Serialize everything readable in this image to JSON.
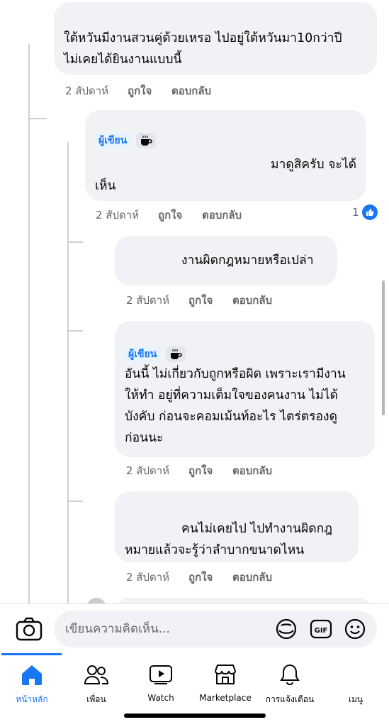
{
  "comments": [
    {
      "text_lines": [
        "ใต้หวันมีงานสวนคู่ด้วยเหรอ ไปอยู่ใต้หวันมา10กว่าปี",
        "ไม่เคยได้ยินงานแบบนี้"
      ],
      "time": "2 สัปดาห์",
      "like": "ถูกใจ",
      "reply": "ตอบกลับ"
    },
    {
      "author_badge": "ผู้เขียน",
      "text_lines": [
        "มาดูสิครับ จะได้",
        "เห็น"
      ],
      "time": "2 สัปดาห์",
      "like": "ถูกใจ",
      "reply": "ตอบกลับ",
      "reaction_count": "1"
    },
    {
      "text_lines": [
        "งานผิดกฎหมายหรือเปล่า"
      ],
      "time": "2 สัปดาห์",
      "like": "ถูกใจ",
      "reply": "ตอบกลับ"
    },
    {
      "author_badge": "ผู้เขียน",
      "text_lines": [
        "อันนี้ ไม่เกี่ยวกับถูกหรือผิด เพราะเรามีงาน",
        "ให้ทำ อยู่ที่ความเต็มใจของคนงาน ไม่ได้",
        "บังคับ ก่อนจะคอมเม้นท์อะไร ไตร่ตรองดู",
        "ก่อนนะ"
      ],
      "time": "2 สัปดาห์",
      "like": "ถูกใจ",
      "reply": "ตอบกลับ"
    },
    {
      "text_lines": [
        "คนไม่เคยไป ไปทำงานผิดกฎ",
        "หมายแล้วจะรู้ว่าลำบากขนาดไหน"
      ],
      "time": "2 สัปดาห์",
      "like": "ถูกใจ",
      "reply": "ตอบกลับ"
    }
  ],
  "composer": {
    "placeholder": "เขียนความคิดเห็น..."
  },
  "icons": {
    "camera": "camera-icon",
    "sticker": "sticker-icon",
    "gif": "GIF",
    "emoji": "emoji-icon"
  },
  "tabs": [
    {
      "label": "หน้าหลัก",
      "icon": "home-icon",
      "active": true
    },
    {
      "label": "เพื่อน",
      "icon": "friends-icon"
    },
    {
      "label": "Watch",
      "icon": "watch-icon"
    },
    {
      "label": "Marketplace",
      "icon": "marketplace-icon"
    },
    {
      "label": "การแจ้งเตือน",
      "icon": "bell-icon"
    },
    {
      "label": "เมนู",
      "icon": "menu-icon"
    }
  ],
  "colors": {
    "accent": "#1877f2",
    "bubble": "#f0f2f5",
    "meta": "#65676b"
  }
}
